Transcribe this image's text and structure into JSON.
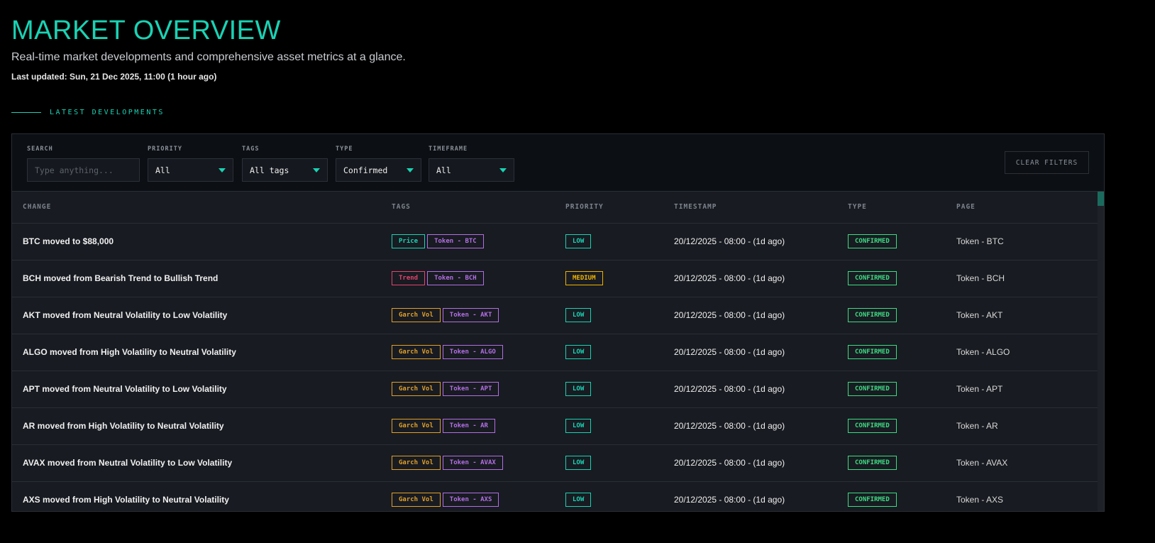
{
  "header": {
    "title": "MARKET OVERVIEW",
    "subtitle": "Real-time market developments and comprehensive asset metrics at a glance.",
    "last_updated": "Last updated: Sun, 21 Dec 2025, 11:00 (1 hour ago)"
  },
  "section_title": "LATEST DEVELOPMENTS",
  "filters": {
    "search": {
      "label": "SEARCH",
      "placeholder": "Type anything..."
    },
    "priority": {
      "label": "PRIORITY",
      "value": "All"
    },
    "tags": {
      "label": "TAGS",
      "value": "All tags"
    },
    "type": {
      "label": "TYPE",
      "value": "Confirmed"
    },
    "timeframe": {
      "label": "TIMEFRAME",
      "value": "All"
    },
    "clear": "CLEAR FILTERS"
  },
  "columns": [
    "CHANGE",
    "TAGS",
    "PRIORITY",
    "TIMESTAMP",
    "TYPE",
    "PAGE"
  ],
  "colors": {
    "accent": "#19d3b4",
    "price": "#19d3b4",
    "token": "#b36ee6",
    "garch": "#e0a02a",
    "trend": "#e0446e",
    "low": "#19d3b4",
    "medium": "#f0b400",
    "confirmed": "#3ddc84"
  },
  "rows": [
    {
      "change": "BTC moved to $88,000",
      "tags": [
        {
          "label": "Price",
          "kind": "price"
        },
        {
          "label": "Token - BTC",
          "kind": "token"
        }
      ],
      "priority": "LOW",
      "timestamp": "20/12/2025 - 08:00 - (1d ago)",
      "type": "CONFIRMED",
      "page": "Token - BTC"
    },
    {
      "change": "BCH moved from Bearish Trend to Bullish Trend",
      "tags": [
        {
          "label": "Trend",
          "kind": "trend"
        },
        {
          "label": "Token - BCH",
          "kind": "token"
        }
      ],
      "priority": "MEDIUM",
      "timestamp": "20/12/2025 - 08:00 - (1d ago)",
      "type": "CONFIRMED",
      "page": "Token - BCH"
    },
    {
      "change": "AKT moved from Neutral Volatility to Low Volatility",
      "tags": [
        {
          "label": "Garch Vol",
          "kind": "garch"
        },
        {
          "label": "Token - AKT",
          "kind": "token"
        }
      ],
      "priority": "LOW",
      "timestamp": "20/12/2025 - 08:00 - (1d ago)",
      "type": "CONFIRMED",
      "page": "Token - AKT"
    },
    {
      "change": "ALGO moved from High Volatility to Neutral Volatility",
      "tags": [
        {
          "label": "Garch Vol",
          "kind": "garch"
        },
        {
          "label": "Token - ALGO",
          "kind": "token"
        }
      ],
      "priority": "LOW",
      "timestamp": "20/12/2025 - 08:00 - (1d ago)",
      "type": "CONFIRMED",
      "page": "Token - ALGO"
    },
    {
      "change": "APT moved from Neutral Volatility to Low Volatility",
      "tags": [
        {
          "label": "Garch Vol",
          "kind": "garch"
        },
        {
          "label": "Token - APT",
          "kind": "token"
        }
      ],
      "priority": "LOW",
      "timestamp": "20/12/2025 - 08:00 - (1d ago)",
      "type": "CONFIRMED",
      "page": "Token - APT"
    },
    {
      "change": "AR moved from High Volatility to Neutral Volatility",
      "tags": [
        {
          "label": "Garch Vol",
          "kind": "garch"
        },
        {
          "label": "Token - AR",
          "kind": "token"
        }
      ],
      "priority": "LOW",
      "timestamp": "20/12/2025 - 08:00 - (1d ago)",
      "type": "CONFIRMED",
      "page": "Token - AR"
    },
    {
      "change": "AVAX moved from Neutral Volatility to Low Volatility",
      "tags": [
        {
          "label": "Garch Vol",
          "kind": "garch"
        },
        {
          "label": "Token - AVAX",
          "kind": "token"
        }
      ],
      "priority": "LOW",
      "timestamp": "20/12/2025 - 08:00 - (1d ago)",
      "type": "CONFIRMED",
      "page": "Token - AVAX"
    },
    {
      "change": "AXS moved from High Volatility to Neutral Volatility",
      "tags": [
        {
          "label": "Garch Vol",
          "kind": "garch"
        },
        {
          "label": "Token - AXS",
          "kind": "token"
        }
      ],
      "priority": "LOW",
      "timestamp": "20/12/2025 - 08:00 - (1d ago)",
      "type": "CONFIRMED",
      "page": "Token - AXS"
    }
  ]
}
